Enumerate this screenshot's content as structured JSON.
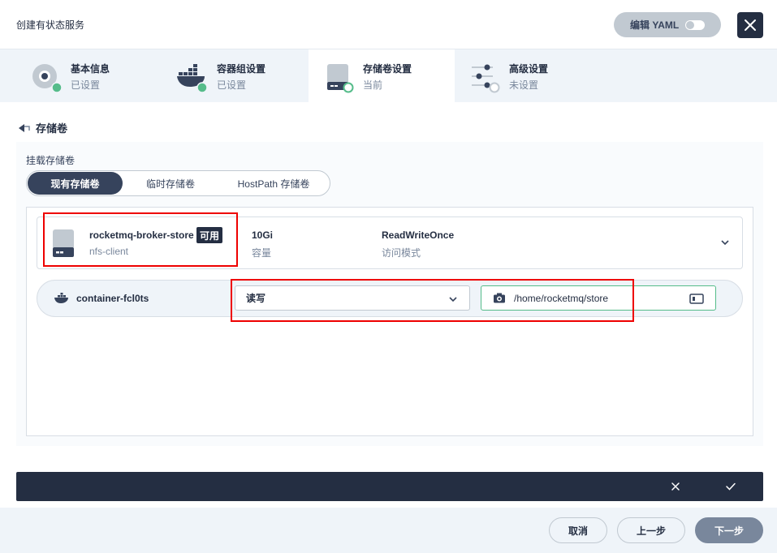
{
  "dialog": {
    "title": "创建有状态服务",
    "yaml_label": "编辑 YAML"
  },
  "tabs": [
    {
      "title": "基本信息",
      "status": "已设置"
    },
    {
      "title": "容器组设置",
      "status": "已设置"
    },
    {
      "title": "存储卷设置",
      "status": "当前"
    },
    {
      "title": "高级设置",
      "status": "未设置"
    }
  ],
  "section": {
    "title": "存储卷"
  },
  "mount": {
    "label": "挂载存储卷",
    "segments": [
      "现有存储卷",
      "临时存储卷",
      "HostPath 存储卷"
    ],
    "selected_segment": "现有存储卷"
  },
  "volume": {
    "name": "rocketmq-broker-store",
    "badge": "可用",
    "storage_class": "nfs-client",
    "capacity": "10Gi",
    "capacity_label": "容量",
    "access_mode": "ReadWriteOnce",
    "access_mode_label": "访问模式"
  },
  "container_mount": {
    "container": "container-fcl0ts",
    "mode": "读写",
    "path": "/home/rocketmq/store"
  },
  "footer": {
    "cancel": "取消",
    "prev": "上一步",
    "next": "下一步"
  },
  "colors": {
    "dark": "#242e42",
    "green": "#55bc8a",
    "highlight": "#ee0000"
  }
}
